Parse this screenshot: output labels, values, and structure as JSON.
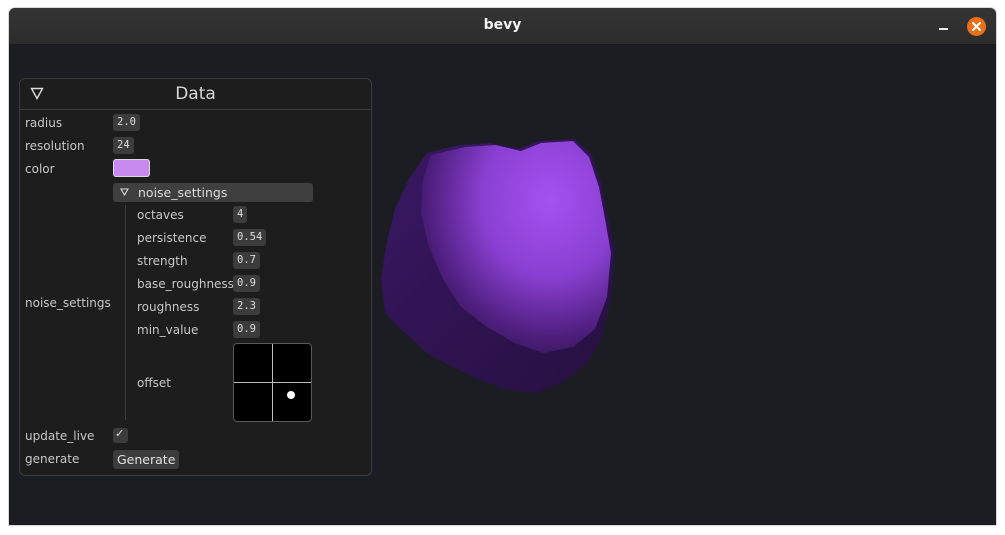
{
  "window": {
    "title": "bevy"
  },
  "panel": {
    "title": "Data",
    "fields": {
      "radius": {
        "label": "radius",
        "value": "2.0"
      },
      "resolution": {
        "label": "resolution",
        "value": "24"
      },
      "color": {
        "label": "color",
        "value": "#c98af0"
      },
      "noise_settings_label": "noise_settings",
      "update_live": {
        "label": "update_live",
        "checked": true,
        "mark": "✓"
      },
      "generate": {
        "label": "generate",
        "button": "Generate"
      }
    },
    "noise_settings": {
      "header": "noise_settings",
      "octaves": {
        "label": "octaves",
        "value": "4"
      },
      "persistence": {
        "label": "persistence",
        "value": "0.54"
      },
      "strength": {
        "label": "strength",
        "value": "0.7"
      },
      "base_roughness": {
        "label": "base_roughness",
        "value": "0.9"
      },
      "roughness": {
        "label": "roughness",
        "value": "2.3"
      },
      "min_value": {
        "label": "min_value",
        "value": "0.9"
      },
      "offset": {
        "label": "offset",
        "x": 0.5,
        "y": -0.35
      }
    }
  },
  "colors": {
    "viewport_bg": "#1b1d22",
    "accent_close": "#e9701b",
    "planet": "#9a4ee0"
  },
  "icons": {
    "collapse": "triangle-down-icon",
    "minimize": "minimize-icon",
    "close": "close-icon"
  }
}
